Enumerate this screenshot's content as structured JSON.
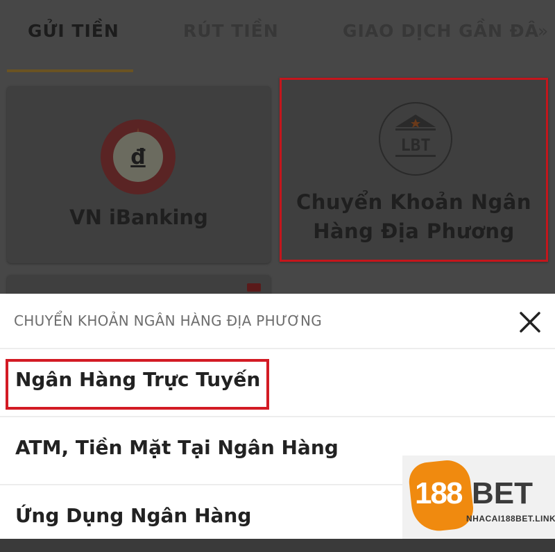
{
  "tabs": {
    "deposit": "GỬI TIỀN",
    "withdraw": "RÚT TIỀN",
    "recent": "GIAO DỊCH GẦN ĐÂ",
    "more": "»"
  },
  "cards": {
    "vn_ibanking": {
      "label": "VN iBanking",
      "icon_text": "đ"
    },
    "local_bank": {
      "label_line1": "Chuyển Khoản Ngân",
      "label_line2": "Hàng Địa Phương",
      "icon_text": "LBT"
    }
  },
  "sheet": {
    "title": "CHUYỂN KHOẢN NGÂN HÀNG ĐỊA PHƯƠNG",
    "close_icon": "close-icon",
    "options": [
      {
        "label": "Ngân Hàng Trực Tuyến"
      },
      {
        "label": "ATM, Tiền Mặt Tại Ngân Hàng"
      },
      {
        "label": "Ứng Dụng Ngân Hàng"
      }
    ]
  },
  "watermark": {
    "brand_number": "188",
    "brand_word": "BET",
    "site": "NHACAI188BET.LINK"
  },
  "colors": {
    "highlight": "#d31b24",
    "brand_orange": "#f08a0f",
    "tab_underline": "#6a5322"
  }
}
